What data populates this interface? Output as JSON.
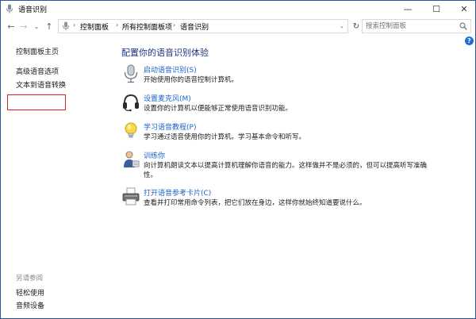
{
  "window": {
    "title": "语音识别",
    "controls": {
      "minimize": "—",
      "maximize": "☐",
      "close": "✕"
    }
  },
  "nav": {
    "back": "←",
    "forward": "→",
    "up": "↑",
    "history": "⌄",
    "breadcrumb": [
      "控制面板",
      "所有控制面板项",
      "语音识别"
    ],
    "separator": "›",
    "refresh": "↻",
    "dropdown": "⌄",
    "search_placeholder": "搜索控制面板"
  },
  "help_label": "?",
  "left_pane": {
    "home_link": "控制面板主页",
    "links": [
      "高级语音选项",
      "文本到语音转换"
    ],
    "see_also_title": "另请参阅",
    "see_also_links": [
      "轻松使用",
      "音频设备"
    ]
  },
  "main": {
    "heading": "配置你的语音识别体验",
    "items": [
      {
        "icon": "microphone-icon",
        "link": "启动语音识别(S)",
        "desc": "开始使用你的语音控制计算机。",
        "desc2": ""
      },
      {
        "icon": "headset-icon",
        "link": "设置麦克风(M)",
        "desc": "设置你的计算机以便能够正常使用语音识别功能。",
        "desc2": ""
      },
      {
        "icon": "lightbulb-icon",
        "link": "学习语音教程(P)",
        "desc": "学习通过语音使用你的计算机。学习基本命令和听写。",
        "desc2": ""
      },
      {
        "icon": "trainer-icon",
        "link": "训练你",
        "desc": "向计算机朗读文本以提高计算机理解你语音的能力。这样做并不是必须的，但可以提高听写准确",
        "desc2": "性。"
      },
      {
        "icon": "printer-icon",
        "link": "打开语音参考卡片(C)",
        "desc": "查看并打印常用命令列表，把它们放在身边，这样你就始终知道要说什么。",
        "desc2": ""
      }
    ]
  },
  "colors": {
    "accent_link": "#1a64c8",
    "heading": "#1e3287",
    "highlight_box": "#e01e1e",
    "window_border": "#2b579a"
  }
}
